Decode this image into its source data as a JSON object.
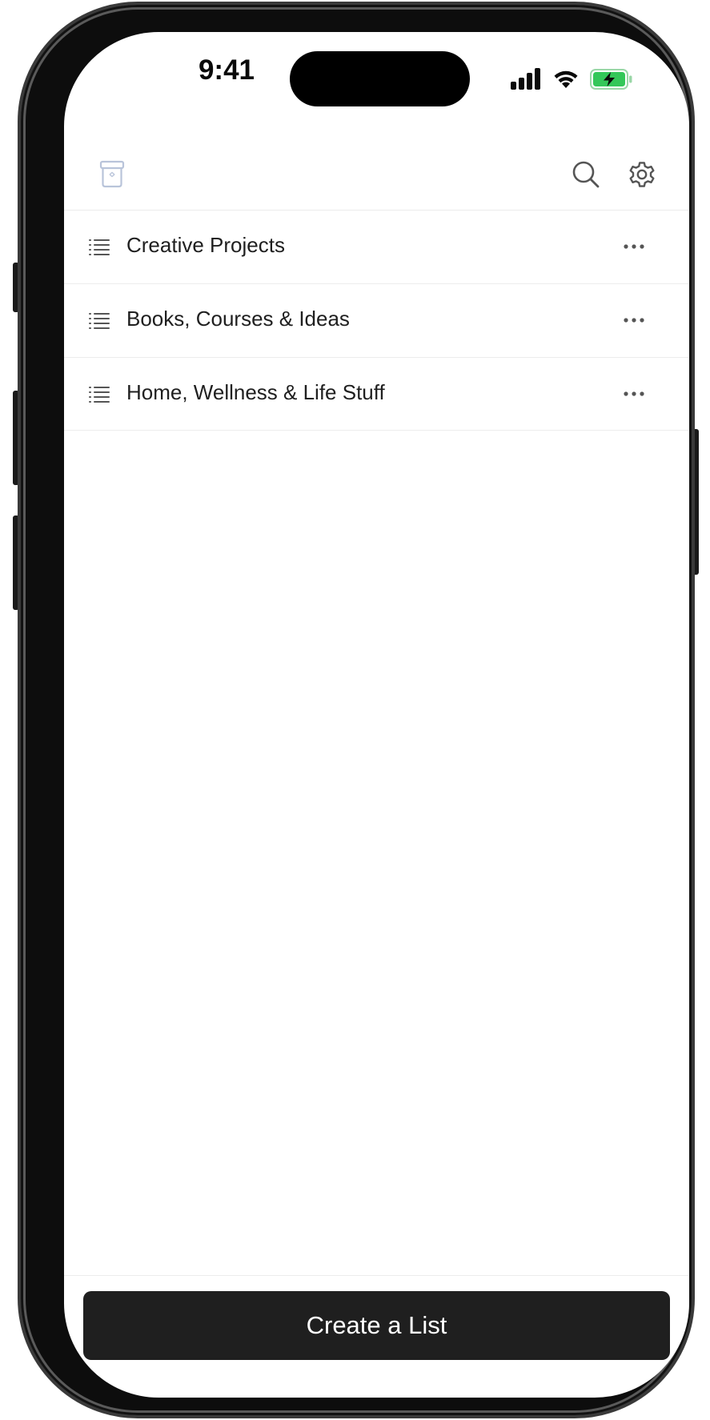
{
  "status_bar": {
    "time": "9:41",
    "signal_icon": "cellular-signal-icon",
    "wifi_icon": "wifi-icon",
    "battery_icon": "battery-charging-icon",
    "battery_color": "#34C759"
  },
  "toolbar": {
    "left_icon": "archive-box-icon",
    "right_icons": [
      "search-icon",
      "gear-icon"
    ],
    "archive_color": "#B9C4DA",
    "icon_color": "#555555"
  },
  "lists": [
    {
      "label": "Creative Projects",
      "icon": "list-icon",
      "menu_icon": "ellipsis-icon"
    },
    {
      "label": "Books, Courses & Ideas",
      "icon": "list-icon",
      "menu_icon": "ellipsis-icon"
    },
    {
      "label": "Home, Wellness & Life Stuff",
      "icon": "list-icon",
      "menu_icon": "ellipsis-icon"
    }
  ],
  "create_button": {
    "label": "Create a List",
    "background": "#1F1F1F"
  }
}
